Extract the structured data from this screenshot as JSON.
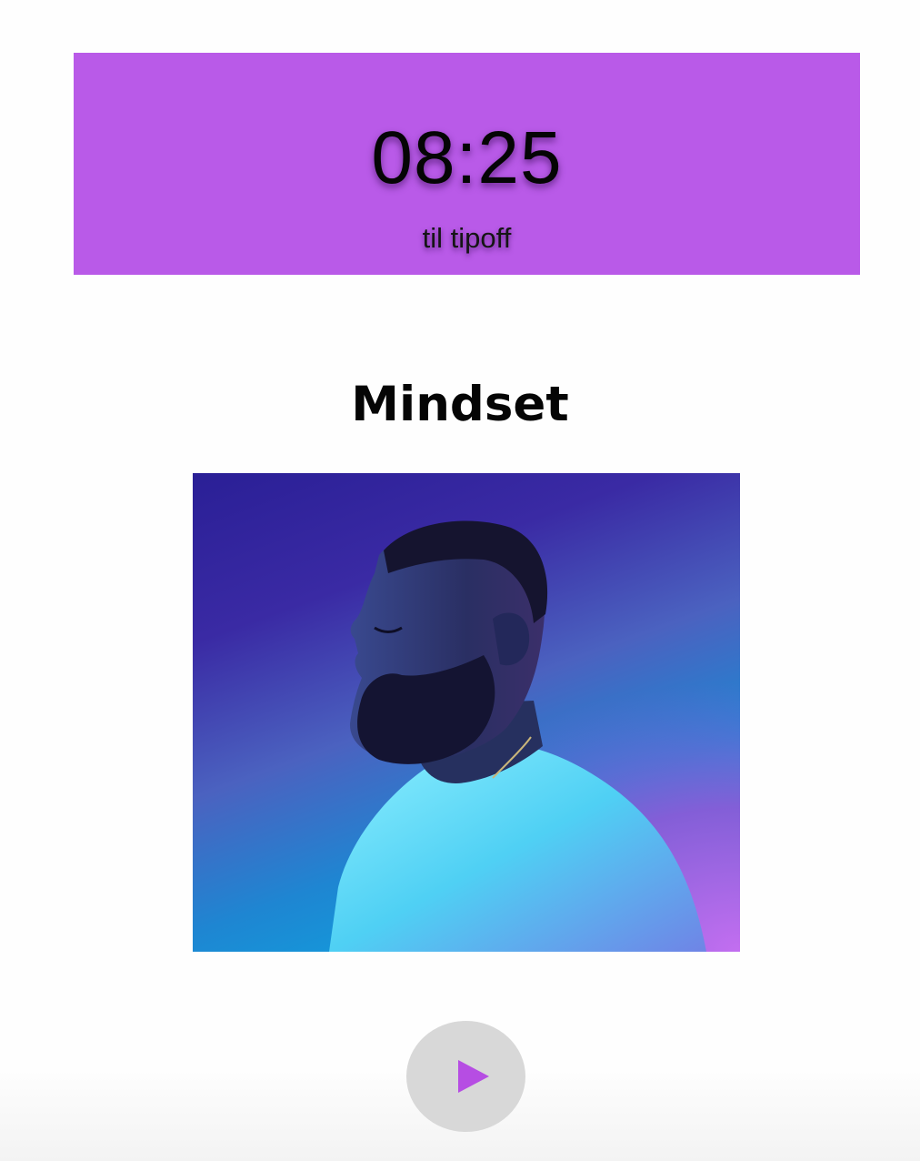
{
  "countdown": {
    "time": "08:25",
    "caption": "til tipoff",
    "background_color": "#b95ae8"
  },
  "section": {
    "title": "Mindset"
  },
  "artwork": {
    "subject": "athlete-portrait",
    "gradient_colors": [
      "#2a1f96",
      "#06b4e6",
      "#c36ef0"
    ]
  },
  "player": {
    "play_icon": "play-icon",
    "button_color": "#d8d8d8",
    "icon_color": "#b64de3"
  }
}
